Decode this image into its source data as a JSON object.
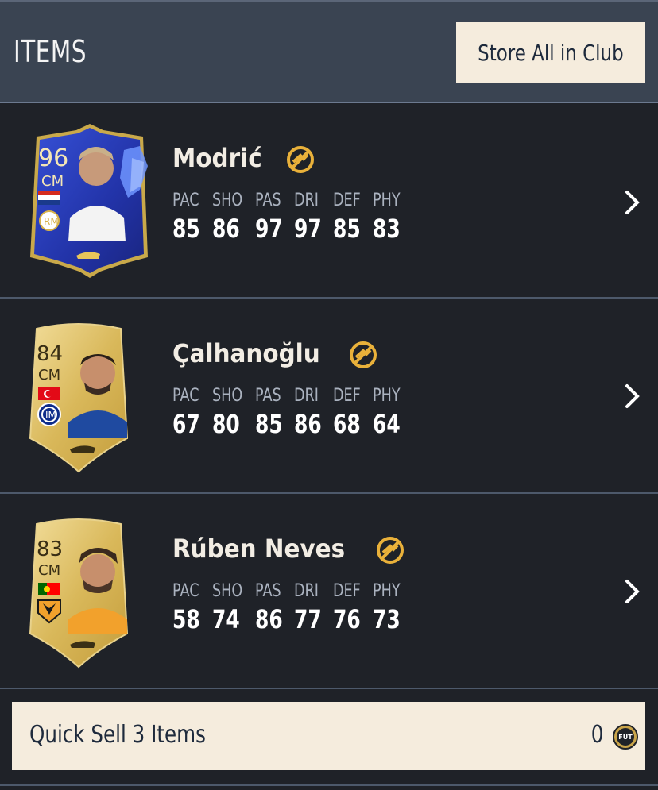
{
  "header": {
    "title": "ITEMS",
    "store_button": "Store All in Club"
  },
  "stat_labels": [
    "PAC",
    "SHO",
    "PAS",
    "DRI",
    "DEF",
    "PHY"
  ],
  "players": [
    {
      "name": "Modrić",
      "rating": "96",
      "position": "CM",
      "card_type": "toty-blue",
      "nation": "Croatia",
      "club": "Real Madrid",
      "stats": [
        "85",
        "86",
        "97",
        "97",
        "85",
        "83"
      ]
    },
    {
      "name": "Çalhanoğlu",
      "rating": "84",
      "position": "CM",
      "card_type": "gold",
      "nation": "Turkey",
      "club": "Inter",
      "stats": [
        "67",
        "80",
        "85",
        "86",
        "68",
        "64"
      ]
    },
    {
      "name": "Rúben Neves",
      "rating": "83",
      "position": "CM",
      "card_type": "gold",
      "nation": "Portugal",
      "club": "Wolves",
      "stats": [
        "58",
        "74",
        "86",
        "77",
        "76",
        "73"
      ]
    }
  ],
  "quick_sell": {
    "label": "Quick Sell 3 Items",
    "value": "0",
    "coin_icon_text": "FUT"
  },
  "icons": {
    "untradeable": "untradeable-icon",
    "chevron": "chevron-right-icon",
    "coin": "coin-icon"
  },
  "colors": {
    "background": "#1f2228",
    "header": "#3a4452",
    "button": "#f5ecdd",
    "untradeable": "#e9b13a",
    "gold_card": "#e3c774",
    "toty_card": "#2f3fb4"
  }
}
